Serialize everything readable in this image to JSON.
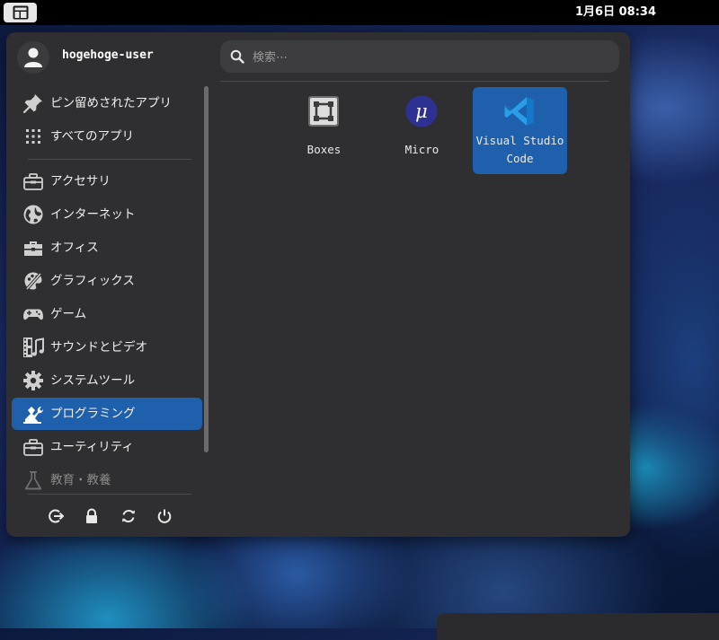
{
  "topbar": {
    "activities_icon": "activities-icon",
    "clock": "1月6日 08:34"
  },
  "user": {
    "name": "hogehoge-user",
    "avatar_icon": "user-icon"
  },
  "search": {
    "placeholder": "検索⋯",
    "icon": "search-icon"
  },
  "sidebar": {
    "pinned": [
      {
        "label": "ピン留めされたアプリ",
        "icon": "pin-icon"
      },
      {
        "label": "すべてのアプリ",
        "icon": "grid-icon"
      }
    ],
    "categories": [
      {
        "label": "アクセサリ",
        "icon": "toolbox-icon"
      },
      {
        "label": "インターネット",
        "icon": "globe-icon"
      },
      {
        "label": "オフィス",
        "icon": "briefcase-icon"
      },
      {
        "label": "グラフィックス",
        "icon": "palette-icon"
      },
      {
        "label": "ゲーム",
        "icon": "gamepad-icon"
      },
      {
        "label": "サウンドとビデオ",
        "icon": "film-music-icon"
      },
      {
        "label": "システムツール",
        "icon": "gear-icon"
      },
      {
        "label": "プログラミング",
        "icon": "programming-icon",
        "active": true
      },
      {
        "label": "ユーティリティ",
        "icon": "toolbox-icon"
      },
      {
        "label": "教育・教養",
        "icon": "flask-icon"
      }
    ]
  },
  "actions": [
    {
      "name": "logout",
      "icon": "logout-icon"
    },
    {
      "name": "lock",
      "icon": "lock-icon"
    },
    {
      "name": "restart",
      "icon": "restart-icon"
    },
    {
      "name": "power",
      "icon": "power-icon"
    }
  ],
  "apps": [
    {
      "label": "Boxes",
      "icon": "boxes-icon",
      "selected": false
    },
    {
      "label": "Micro",
      "icon": "micro-icon",
      "selected": false
    },
    {
      "label_line1": "Visual Studio",
      "label_line2": "Code",
      "icon": "vscode-icon",
      "selected": true
    }
  ],
  "colors": {
    "accent": "#1f60ad",
    "panel": "#2f2f31",
    "topbar": "#000000"
  }
}
